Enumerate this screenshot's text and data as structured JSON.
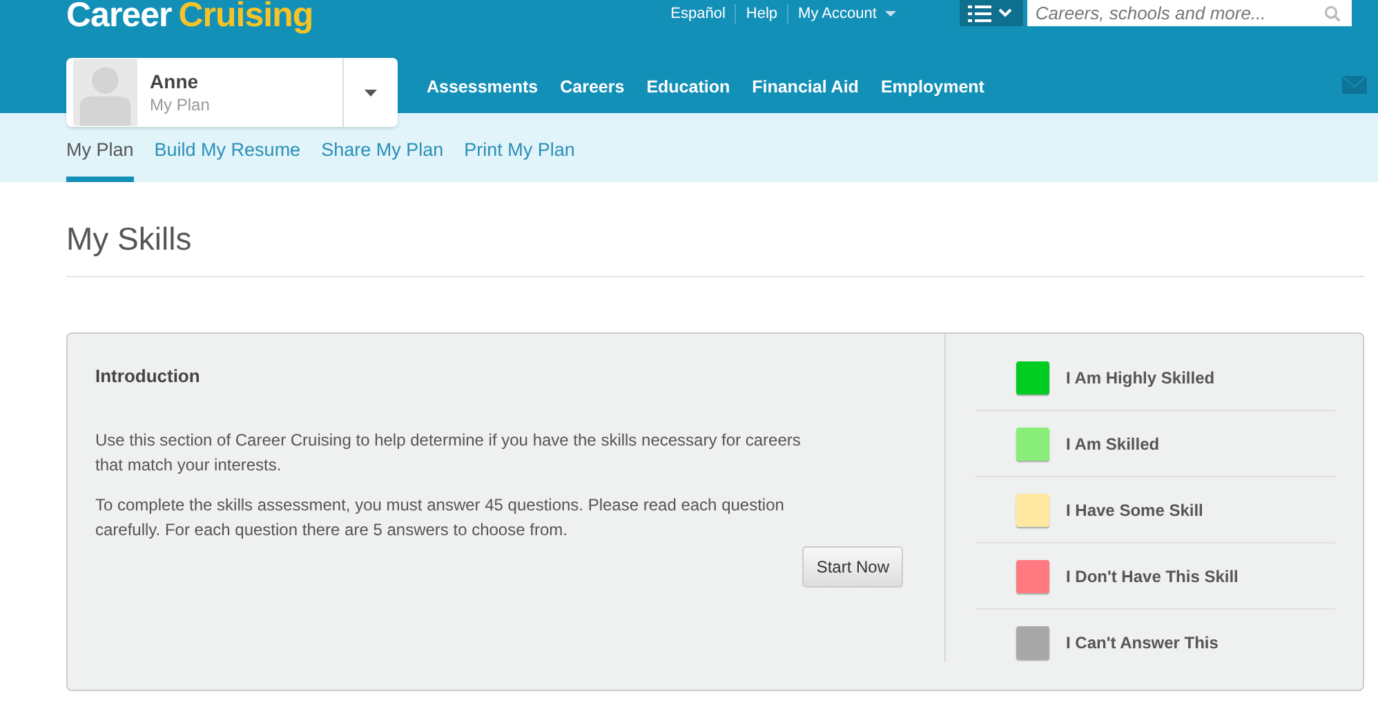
{
  "logo": {
    "word_1": "Career",
    "word_2": "Cruising"
  },
  "top_links": [
    "Español",
    "Help",
    "My Account"
  ],
  "search": {
    "placeholder": "Careers, schools and more..."
  },
  "profile": {
    "name": "Anne",
    "subtitle": "My Plan"
  },
  "main_nav": [
    "Assessments",
    "Careers",
    "Education",
    "Financial Aid",
    "Employment"
  ],
  "sub_tabs": [
    {
      "label": "My Plan",
      "selected": true
    },
    {
      "label": "Build My Resume",
      "selected": false
    },
    {
      "label": "Share My Plan",
      "selected": false
    },
    {
      "label": "Print My Plan",
      "selected": false
    }
  ],
  "page_title": "My Skills",
  "introduction": {
    "heading": "Introduction",
    "paragraphs": [
      "Use this section of Career Cruising to help determine if you have the skills necessary for careers that match your interests.",
      "To complete the skills assessment, you must answer 45 questions. Please read each question carefully. For each question there are 5 answers to choose from."
    ],
    "button": "Start Now"
  },
  "legend": [
    {
      "label": "I Am Highly Skilled",
      "color": "#00cc22"
    },
    {
      "label": "I Am Skilled",
      "color": "#88ee77"
    },
    {
      "label": "I Have Some Skill",
      "color": "#ffe8a0"
    },
    {
      "label": "I Don't Have This Skill",
      "color": "#ff7a80"
    },
    {
      "label": "I Can't Answer This",
      "color": "#a8a8a8"
    }
  ]
}
